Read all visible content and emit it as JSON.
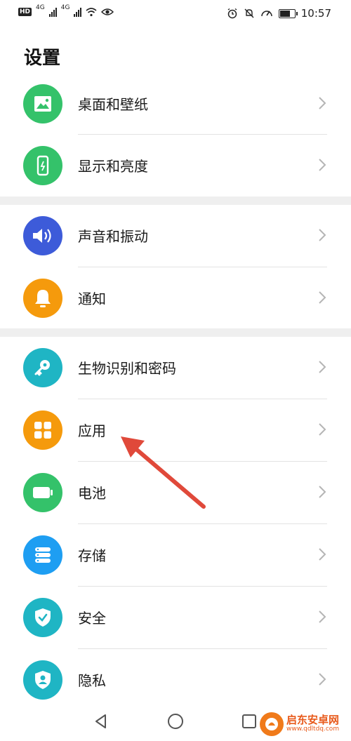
{
  "status_bar": {
    "left_badge": "HD",
    "network1": "4G",
    "network2": "4G",
    "time": "10:57",
    "icons": [
      "alarm-icon",
      "mute-icon",
      "speed-icon",
      "battery-icon"
    ]
  },
  "page": {
    "title": "设置"
  },
  "settings": {
    "items": [
      {
        "label": "桌面和壁纸",
        "icon": "wallpaper-icon",
        "color": "#34c26a"
      },
      {
        "label": "显示和亮度",
        "icon": "display-icon",
        "color": "#34c26a"
      },
      {
        "label": "声音和振动",
        "icon": "sound-icon",
        "color": "#3d5bd9"
      },
      {
        "label": "通知",
        "icon": "bell-icon",
        "color": "#f59a0c"
      },
      {
        "label": "生物识别和密码",
        "icon": "key-icon",
        "color": "#1fb5c4"
      },
      {
        "label": "应用",
        "icon": "apps-icon",
        "color": "#f59a0c"
      },
      {
        "label": "电池",
        "icon": "battery-icon",
        "color": "#34c26a"
      },
      {
        "label": "存储",
        "icon": "storage-icon",
        "color": "#1e9ef2"
      },
      {
        "label": "安全",
        "icon": "shield-icon",
        "color": "#1fb5c4"
      },
      {
        "label": "隐私",
        "icon": "privacy-icon",
        "color": "#1fb5c4"
      }
    ]
  },
  "nav_bar": {
    "buttons": [
      "back-icon",
      "home-icon",
      "recents-icon"
    ]
  },
  "annotation": {
    "arrow_color": "#e0493a"
  },
  "watermark": {
    "title": "启东安卓网",
    "url": "www.qdltdq.com"
  }
}
